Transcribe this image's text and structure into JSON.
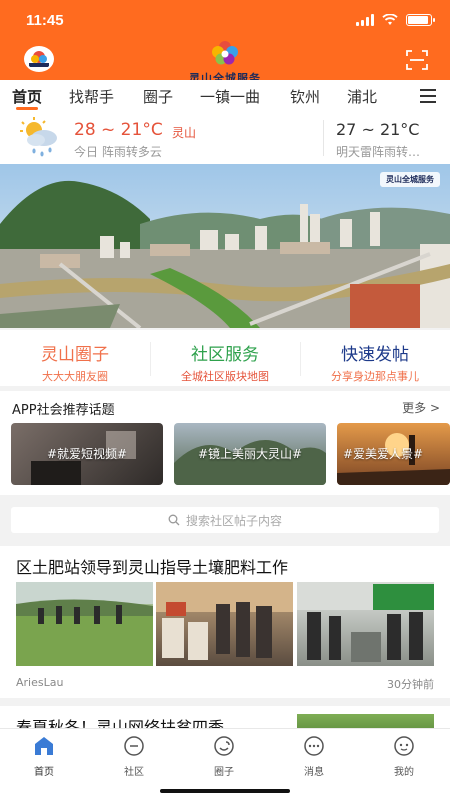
{
  "status": {
    "time": "11:45",
    "battery_level": 0.9
  },
  "header": {
    "logo_text": "灵山全城服务"
  },
  "nav": {
    "tabs": [
      "首页",
      "找帮手",
      "圈子",
      "一镇一曲",
      "钦州",
      "浦北"
    ],
    "active_index": 0
  },
  "weather": {
    "today_temp": "28 ~ 21°C",
    "city": "灵山",
    "today_desc": "今日 阵雨转多云",
    "tomorrow_temp": "27 ~ 21°C",
    "tomorrow_desc": "明天雷阵雨转…"
  },
  "banner": {
    "watermark": "灵山全城服务"
  },
  "features": [
    {
      "title": "灵山圈子",
      "subtitle": "大大大朋友圈",
      "color": "#f0704a"
    },
    {
      "title": "社区服务",
      "subtitle": "全城社区版块地图",
      "color": "#2ea14c",
      "sub_color": "#e5533a"
    },
    {
      "title": "快速发帖",
      "subtitle": "分享身边那点事儿",
      "color": "#1d3a8a",
      "sub_color": "#f0704a"
    }
  ],
  "topics": {
    "title": "APP社会推荐话题",
    "more": "更多 >",
    "items": [
      "#就爱短视频#",
      "#镜上美丽大灵山#",
      "#爱美爱人景#"
    ]
  },
  "search": {
    "placeholder": "搜索社区帖子内容"
  },
  "posts": [
    {
      "title": "区土肥站领导到灵山指导土壤肥料工作",
      "author": "AriesLau",
      "time": "30分钟前"
    },
    {
      "title": "春夏秋冬！灵山网络扶贫四季"
    }
  ],
  "bottom_nav": [
    "首页",
    "社区",
    "圈子",
    "消息",
    "我的"
  ],
  "colors": {
    "brand": "#ff6b1f",
    "accent_red": "#e5533a"
  }
}
